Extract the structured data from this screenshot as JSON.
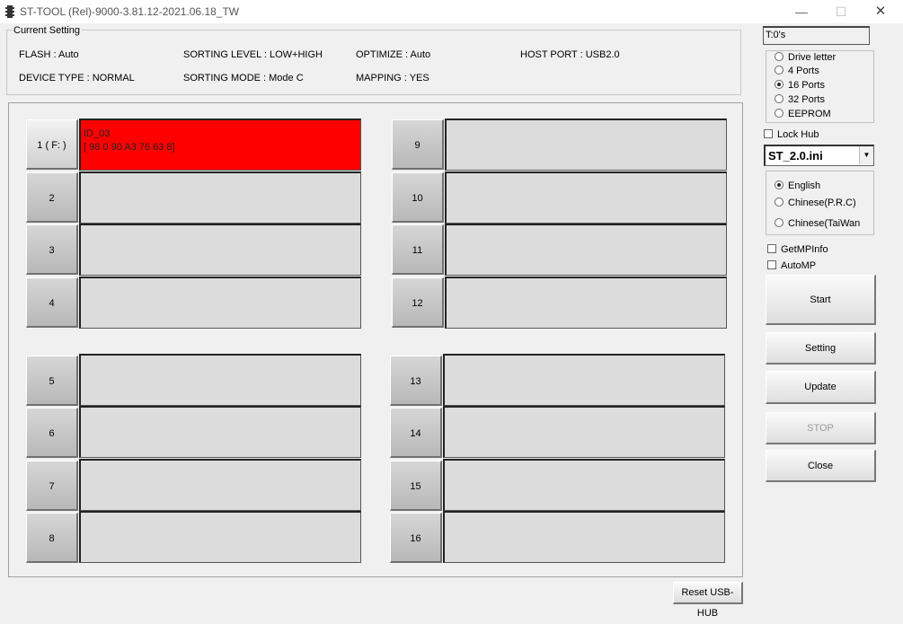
{
  "window": {
    "title": "ST-TOOL (Rel)-9000-3.81.12-2021.06.18_TW",
    "min_glyph": "—",
    "max_glyph": "☐",
    "close_glyph": "✕"
  },
  "current_setting": {
    "legend": "Current Setting",
    "flash": "FLASH : Auto",
    "sorting_level": "SORTING LEVEL : LOW+HIGH",
    "optimize": "OPTIMIZE : Auto",
    "host_port": "HOST PORT : USB2.0",
    "device_type": "DEVICE TYPE : NORMAL",
    "sorting_mode": "SORTING MODE : Mode C",
    "mapping": "MAPPING : YES"
  },
  "ports": [
    {
      "label": "1 ( F: )",
      "line1": "ID_03",
      "line2": "[ 98 0 90 A3 76 63 8]",
      "active": true
    },
    {
      "label": "2",
      "line1": "",
      "line2": "",
      "active": false
    },
    {
      "label": "3",
      "line1": "",
      "line2": "",
      "active": false
    },
    {
      "label": "4",
      "line1": "",
      "line2": "",
      "active": false
    },
    {
      "label": "5",
      "line1": "",
      "line2": "",
      "active": false
    },
    {
      "label": "6",
      "line1": "",
      "line2": "",
      "active": false
    },
    {
      "label": "7",
      "line1": "",
      "line2": "",
      "active": false
    },
    {
      "label": "8",
      "line1": "",
      "line2": "",
      "active": false
    },
    {
      "label": "9",
      "line1": "",
      "line2": "",
      "active": false
    },
    {
      "label": "10",
      "line1": "",
      "line2": "",
      "active": false
    },
    {
      "label": "11",
      "line1": "",
      "line2": "",
      "active": false
    },
    {
      "label": "12",
      "line1": "",
      "line2": "",
      "active": false
    },
    {
      "label": "13",
      "line1": "",
      "line2": "",
      "active": false
    },
    {
      "label": "14",
      "line1": "",
      "line2": "",
      "active": false
    },
    {
      "label": "15",
      "line1": "",
      "line2": "",
      "active": false
    },
    {
      "label": "16",
      "line1": "",
      "line2": "",
      "active": false
    }
  ],
  "colors": {
    "active_port": "#ff0000",
    "idle_port": "#dcdcdc"
  },
  "timer": "T:0's",
  "port_mode_options": [
    {
      "label": "Drive letter",
      "checked": false
    },
    {
      "label": "4 Ports",
      "checked": false
    },
    {
      "label": "16 Ports",
      "checked": true
    },
    {
      "label": "32 Ports",
      "checked": false
    },
    {
      "label": "EEPROM",
      "checked": false
    }
  ],
  "lock_hub": {
    "label": "Lock Hub",
    "checked": false
  },
  "ini_select": {
    "value": "ST_2.0.ini",
    "arrow_glyph": "▼"
  },
  "language_options": [
    {
      "label": "English",
      "checked": true
    },
    {
      "label": "Chinese(P.R.C)",
      "checked": false
    },
    {
      "label": "Chinese(TaiWan",
      "checked": false
    }
  ],
  "get_mp_info": {
    "label": "GetMPInfo",
    "checked": false
  },
  "auto_mp": {
    "label": "AutoMP",
    "checked": false
  },
  "buttons": {
    "start": "Start",
    "setting": "Setting",
    "update": "Update",
    "stop": "STOP",
    "close": "Close",
    "reset_hub": "Reset USB-HUB"
  }
}
